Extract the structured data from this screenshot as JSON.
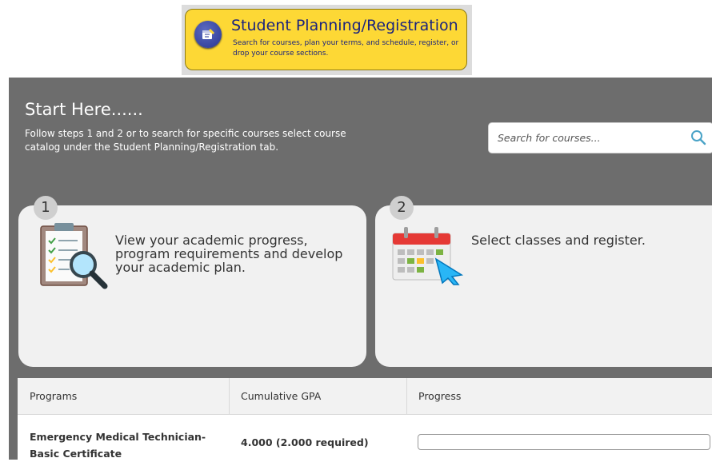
{
  "top_menu": {
    "title": "Student Planning/Registration",
    "description": "Search for courses, plan your terms, and schedule, register, or drop your course sections.",
    "icon": "planning-icon"
  },
  "start": {
    "title": "Start Here......",
    "description": "Follow steps 1 and 2 or to search for specific courses select course catalog under the Student Planning/Registration tab."
  },
  "search": {
    "placeholder": "Search for courses...",
    "icon": "search-icon"
  },
  "steps": [
    {
      "number": "1",
      "text": "View your academic progress, program requirements and develop your academic plan.",
      "icon": "clipboard-magnifier-icon"
    },
    {
      "number": "2",
      "text": "Select classes and register.",
      "icon": "calendar-cursor-icon"
    }
  ],
  "programs_table": {
    "headers": [
      "Programs",
      "Cumulative GPA",
      "Progress"
    ],
    "rows": [
      {
        "program": "Emergency Medical Technician-Basic Certificate",
        "gpa": "4.000 (2.000 required)",
        "progress": 0
      }
    ]
  },
  "colors": {
    "accent_yellow": "#fdd835",
    "dark_panel": "#6d6d6d",
    "card_bg": "#f1f1f1",
    "icon_blue": "#3949ab"
  }
}
